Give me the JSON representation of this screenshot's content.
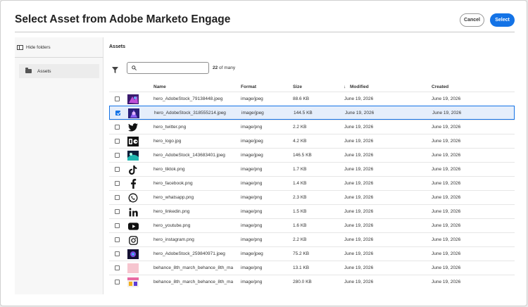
{
  "dialog": {
    "title": "Select Asset from Adobe Marketo Engage",
    "cancel_label": "Cancel",
    "select_label": "Select"
  },
  "sidebar": {
    "hide_folders_label": "Hide folders",
    "folders": [
      {
        "label": "Assets",
        "icon": "folder-icon"
      }
    ]
  },
  "main": {
    "section_title": "Assets",
    "search": {
      "value": "",
      "placeholder": ""
    },
    "count_number": "22",
    "count_suffix": " of many"
  },
  "table": {
    "columns": {
      "name": "Name",
      "format": "Format",
      "size": "Size",
      "modified": "Modified",
      "created": "Created"
    },
    "sorted_column": "modified",
    "sort_direction": "descending",
    "rows": [
      {
        "name": "hero_AdobeStock_79138448.jpeg",
        "format": "image/jpeg",
        "size": "88.6 KB",
        "modified": "June 19, 2026",
        "created": "June 19, 2026",
        "thumb": "stock-photo-purple",
        "checked": false
      },
      {
        "name": "hero_AdobeStock_318555214.jpeg",
        "format": "image/jpeg",
        "size": "144.5 KB",
        "modified": "June 19, 2026",
        "created": "June 19, 2026",
        "thumb": "stock-photo-violet",
        "checked": true
      },
      {
        "name": "hero_twitter.png",
        "format": "image/png",
        "size": "2.2 KB",
        "modified": "June 19, 2026",
        "created": "June 19, 2026",
        "thumb": "twitter-icon",
        "checked": false
      },
      {
        "name": "hero_logo.jpg",
        "format": "image/jpeg",
        "size": "4.2 KB",
        "modified": "June 19, 2026",
        "created": "June 19, 2026",
        "thumb": "logo-image",
        "checked": false
      },
      {
        "name": "hero_AdobeStock_143683401.jpeg",
        "format": "image/jpeg",
        "size": "146.5 KB",
        "modified": "June 19, 2026",
        "created": "June 19, 2026",
        "thumb": "stock-photo-teal",
        "checked": false
      },
      {
        "name": "hero_tiktok.png",
        "format": "image/png",
        "size": "1.7 KB",
        "modified": "June 19, 2026",
        "created": "June 19, 2026",
        "thumb": "tiktok-icon",
        "checked": false
      },
      {
        "name": "hero_facebook.png",
        "format": "image/png",
        "size": "1.4 KB",
        "modified": "June 19, 2026",
        "created": "June 19, 2026",
        "thumb": "facebook-icon",
        "checked": false
      },
      {
        "name": "hero_whatsapp.png",
        "format": "image/png",
        "size": "2.3 KB",
        "modified": "June 19, 2026",
        "created": "June 19, 2026",
        "thumb": "whatsapp-icon",
        "checked": false
      },
      {
        "name": "hero_linkedin.png",
        "format": "image/png",
        "size": "1.5 KB",
        "modified": "June 19, 2026",
        "created": "June 19, 2026",
        "thumb": "linkedin-icon",
        "checked": false
      },
      {
        "name": "hero_youtube.png",
        "format": "image/png",
        "size": "1.6 KB",
        "modified": "June 19, 2026",
        "created": "June 19, 2026",
        "thumb": "youtube-icon",
        "checked": false
      },
      {
        "name": "hero_instagram.png",
        "format": "image/png",
        "size": "2.2 KB",
        "modified": "June 19, 2026",
        "created": "June 19, 2026",
        "thumb": "instagram-icon",
        "checked": false
      },
      {
        "name": "hero_AdobeStock_259840971.jpeg",
        "format": "image/jpeg",
        "size": "75.2 KB",
        "modified": "June 19, 2026",
        "created": "June 19, 2026",
        "thumb": "stock-photo-dark",
        "checked": false
      },
      {
        "name": "behance_8th_march_behance_8th_ma",
        "format": "image/png",
        "size": "13.1 KB",
        "modified": "June 19, 2026",
        "created": "June 19, 2026",
        "thumb": "pink-swatch",
        "checked": false
      },
      {
        "name": "behance_8th_march_behance_8th_ma",
        "format": "image/png",
        "size": "280.0 KB",
        "modified": "June 19, 2026",
        "created": "June 19, 2026",
        "thumb": "poster-thumbnail",
        "checked": false
      }
    ]
  },
  "colors": {
    "accent": "#1473e6",
    "selected_row": "#e5eefb"
  }
}
